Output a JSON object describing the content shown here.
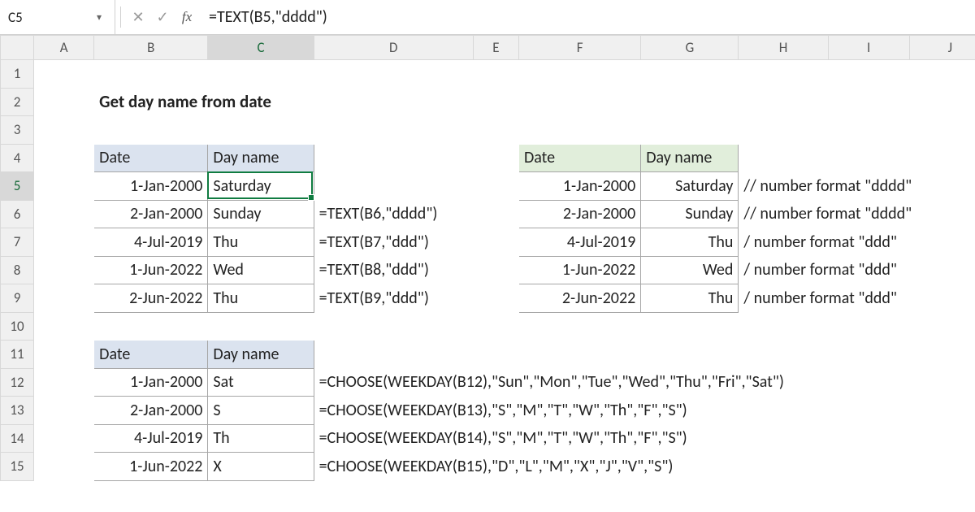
{
  "formula_bar": {
    "cell_ref": "C5",
    "formula": "=TEXT(B5,\"dddd\")"
  },
  "columns": [
    "A",
    "B",
    "C",
    "D",
    "E",
    "F",
    "G",
    "H",
    "I",
    "J"
  ],
  "rows": [
    "1",
    "2",
    "3",
    "4",
    "5",
    "6",
    "7",
    "8",
    "9",
    "10",
    "11",
    "12",
    "13",
    "14",
    "15"
  ],
  "active_col": "C",
  "active_row": "5",
  "title": "Get day name from date",
  "headers": {
    "date": "Date",
    "dayname": "Day name"
  },
  "table1": [
    {
      "date": "1-Jan-2000",
      "day": "Saturday",
      "formula": ""
    },
    {
      "date": "2-Jan-2000",
      "day": "Sunday",
      "formula": "=TEXT(B6,\"dddd\")"
    },
    {
      "date": "4-Jul-2019",
      "day": "Thu",
      "formula": "=TEXT(B7,\"ddd\")"
    },
    {
      "date": "1-Jun-2022",
      "day": "Wed",
      "formula": "=TEXT(B8,\"ddd\")"
    },
    {
      "date": "2-Jun-2022",
      "day": "Thu",
      "formula": "=TEXT(B9,\"ddd\")"
    }
  ],
  "table2": [
    {
      "date": "1-Jan-2000",
      "day": "Saturday",
      "note": "// number format \"dddd\""
    },
    {
      "date": "2-Jan-2000",
      "day": "Sunday",
      "note": "// number format \"dddd\""
    },
    {
      "date": "4-Jul-2019",
      "day": "Thu",
      "note": "/ number format \"ddd\""
    },
    {
      "date": "1-Jun-2022",
      "day": "Wed",
      "note": "/ number format \"ddd\""
    },
    {
      "date": "2-Jun-2022",
      "day": "Thu",
      "note": "/ number format \"ddd\""
    }
  ],
  "table3": [
    {
      "date": "1-Jan-2000",
      "day": "Sat",
      "formula": "=CHOOSE(WEEKDAY(B12),\"Sun\",\"Mon\",\"Tue\",\"Wed\",\"Thu\",\"Fri\",\"Sat\")"
    },
    {
      "date": "2-Jan-2000",
      "day": "S",
      "formula": "=CHOOSE(WEEKDAY(B13),\"S\",\"M\",\"T\",\"W\",\"Th\",\"F\",\"S\")"
    },
    {
      "date": "4-Jul-2019",
      "day": "Th",
      "formula": "=CHOOSE(WEEKDAY(B14),\"S\",\"M\",\"T\",\"W\",\"Th\",\"F\",\"S\")"
    },
    {
      "date": "1-Jun-2022",
      "day": "X",
      "formula": "=CHOOSE(WEEKDAY(B15),\"D\",\"L\",\"M\",\"X\",\"J\",\"V\",\"S\")"
    }
  ]
}
